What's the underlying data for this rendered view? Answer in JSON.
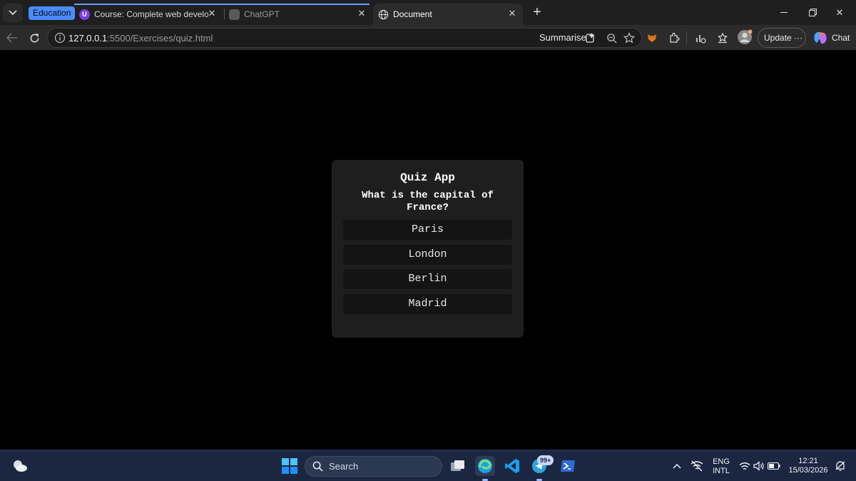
{
  "browser": {
    "tab_group_label": "Education",
    "tabs": [
      {
        "title": "Course: Complete web developme",
        "favicon": "course-icon"
      },
      {
        "title": "ChatGPT",
        "favicon": "chatgpt-icon"
      },
      {
        "title": "Document",
        "favicon": "globe-icon",
        "active": true
      }
    ],
    "address": {
      "host": "127.0.0.1",
      "rest": ":5500/Exercises/quiz.html"
    },
    "summarise_label": "Summarise",
    "update_label": "Update",
    "update_more": "···",
    "chat_label": "Chat"
  },
  "quiz": {
    "title": "Quiz App",
    "question": "What is the capital of France?",
    "answers": [
      "Paris",
      "London",
      "Berlin",
      "Madrid"
    ]
  },
  "taskbar": {
    "search_label": "Search",
    "badge": "99+",
    "language": "ENG",
    "layout": "INTL",
    "time": "12:21",
    "date": "15/03/2026"
  },
  "colors": {
    "card_bg": "#1f1e1e",
    "answer_bg": "#141414",
    "page_bg": "#000000",
    "group_accent": "#4a8cff"
  }
}
